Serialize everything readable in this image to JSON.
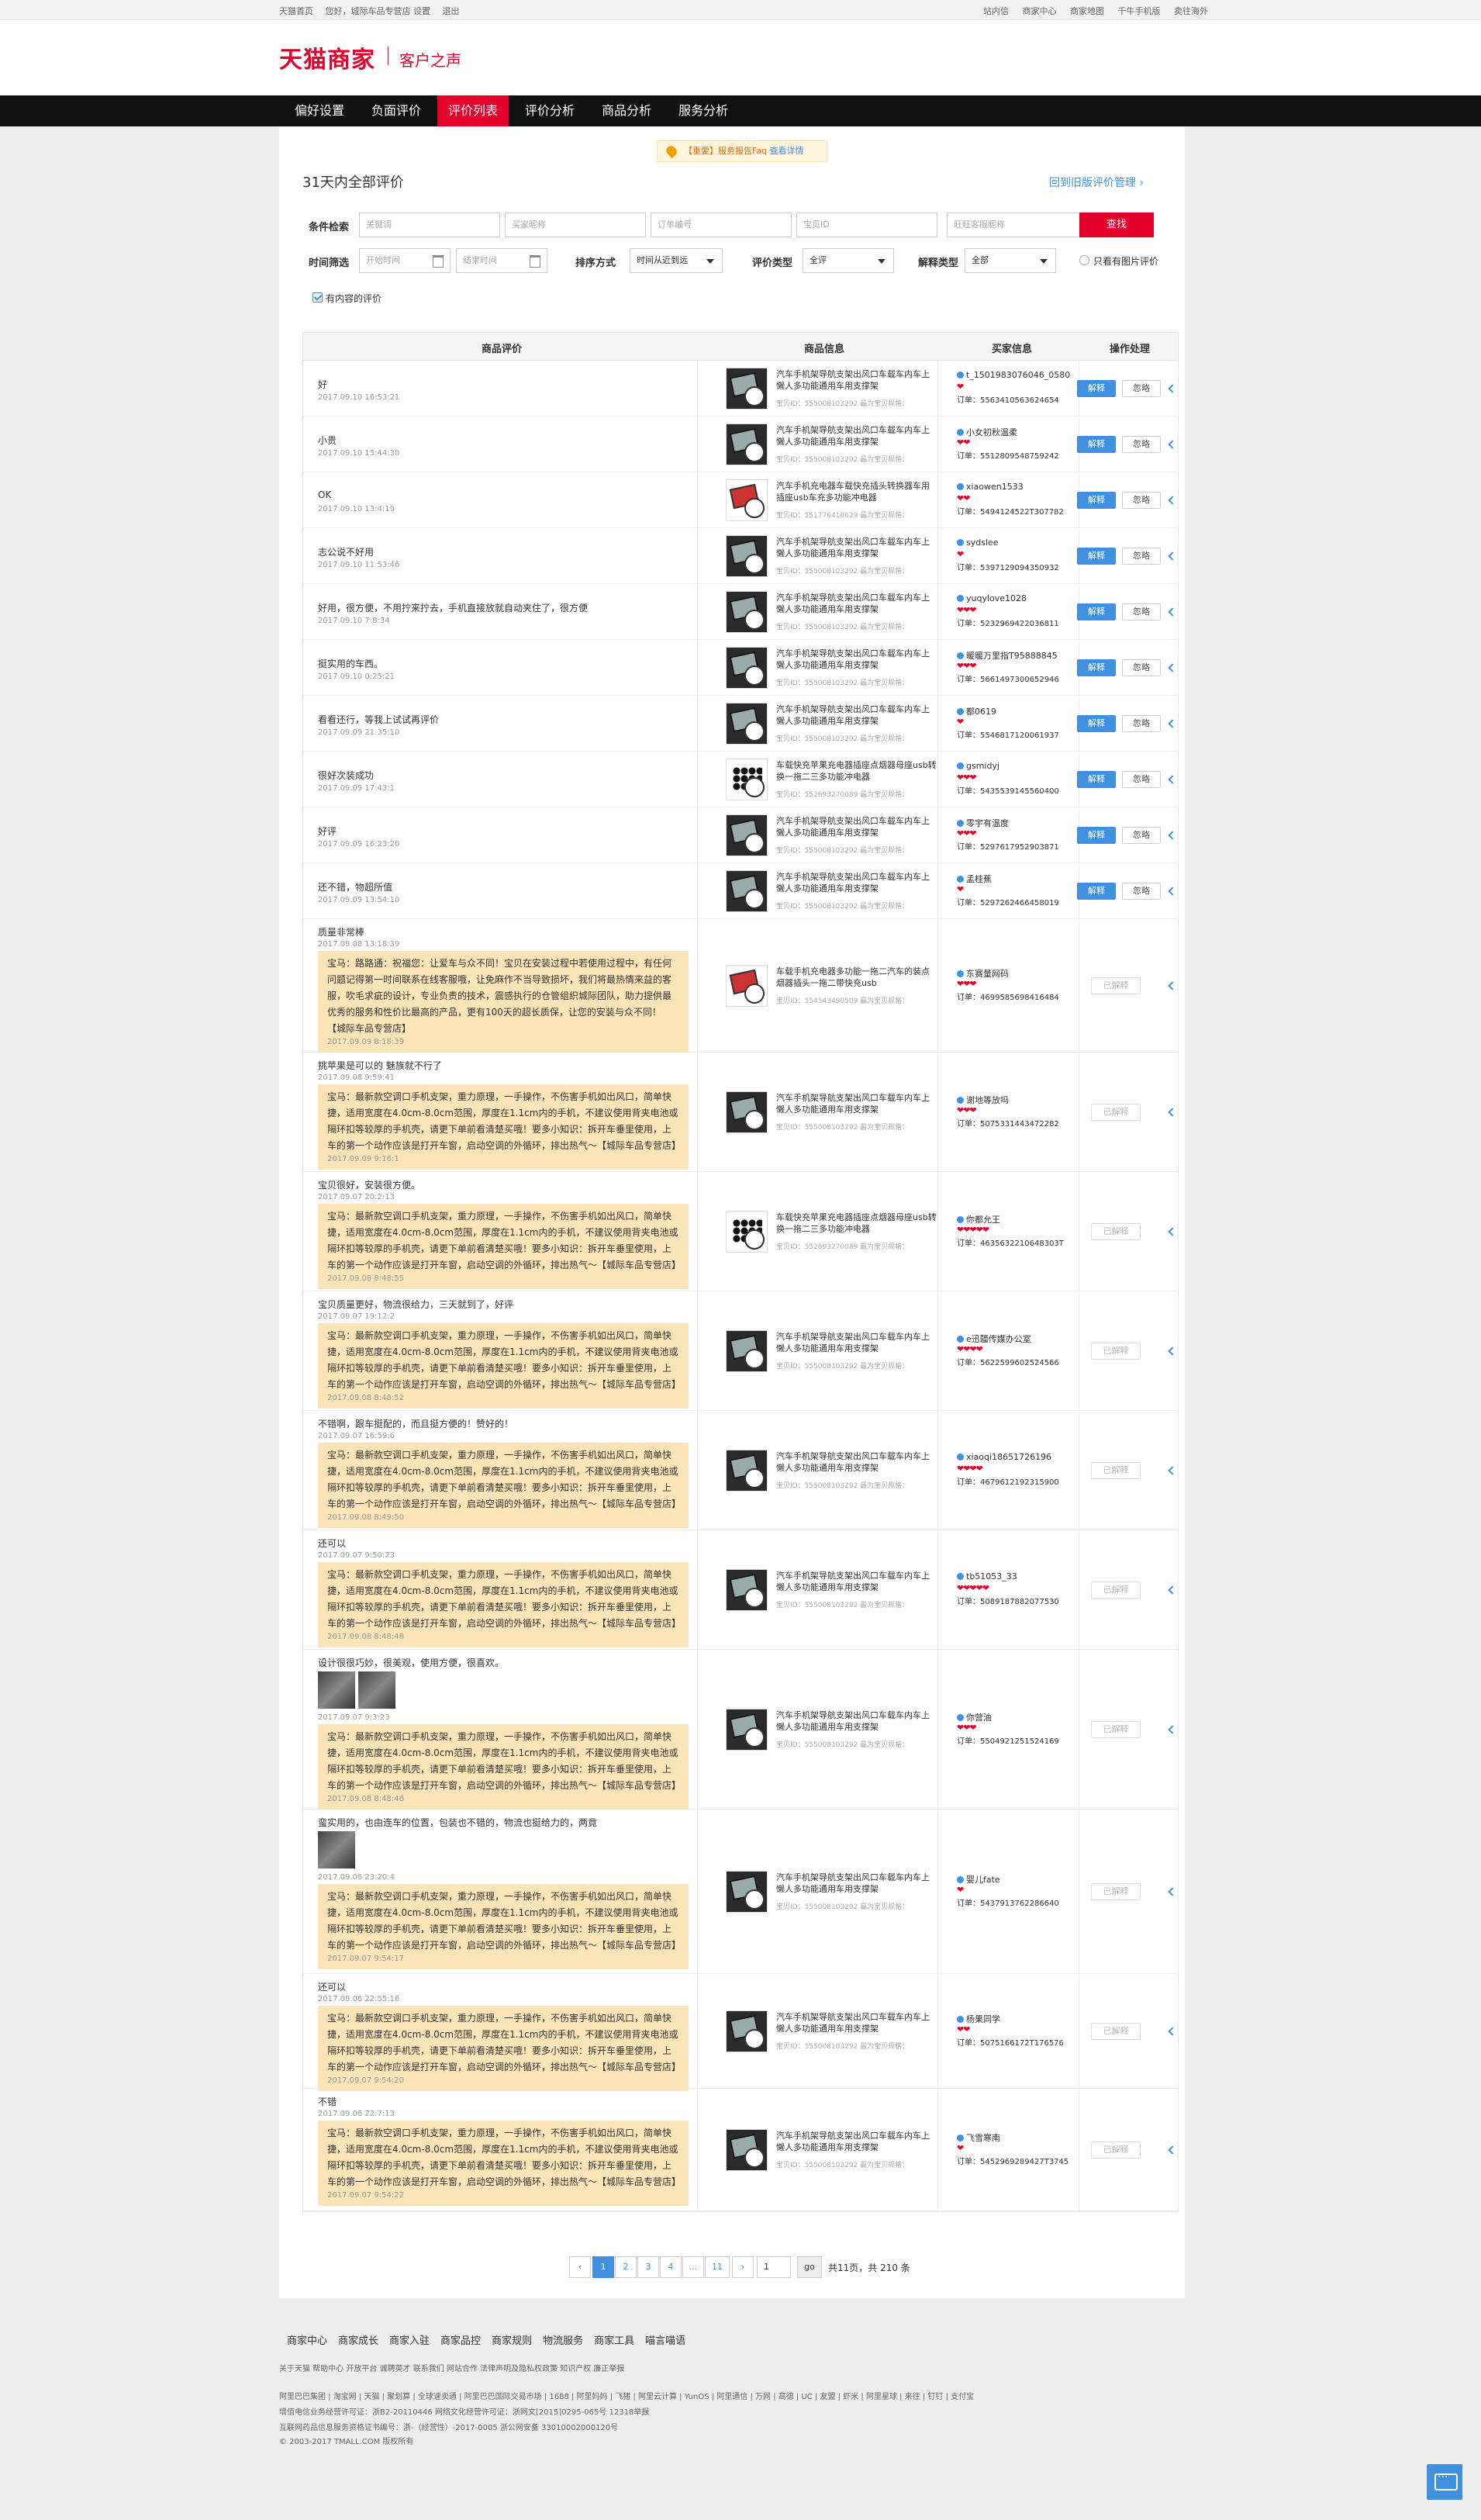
{
  "topbar": {
    "left": [
      "天猫首页",
      "您好，城际车品专营店 设置",
      "退出"
    ],
    "right": [
      "站内信",
      "商家中心",
      "商家地图",
      "千牛手机版",
      "卖往海外"
    ]
  },
  "header": {
    "logo": "天猫商家",
    "subtitle": "客户之声"
  },
  "nav": [
    "偏好设置",
    "负面评价",
    "评价列表",
    "评价分析",
    "商品分析",
    "服务分析"
  ],
  "notice": {
    "tag": "【重要】服务报告Faq",
    "link": "查看详情"
  },
  "page_title": "31天内全部评价",
  "back_link": "回到旧版评价管理 ›",
  "filters": {
    "cond_label": "条件检索",
    "kw": "关键词",
    "buyer": "买家昵称",
    "order": "订单编号",
    "item": "宝贝ID",
    "ww": "旺旺客服昵称",
    "search": "查找",
    "time_label": "时间筛选",
    "start": "开始时间",
    "end": "结束时间",
    "sort_label": "排序方式",
    "sort_val": "时间从近到远",
    "type_label": "评价类型",
    "type_val": "全评",
    "reply_label": "解释类型",
    "reply_val": "全部",
    "img_only": "只看有图片评价",
    "has_content": "有内容的评价"
  },
  "table": {
    "headers": [
      "商品评价",
      "商品信息",
      "买家信息",
      "操作处理"
    ]
  },
  "rows": [
    {
      "text": "好",
      "date": "2017.09.10 16:53:21",
      "pname": "汽车手机架导航支架出风口车载车内车上懒人多功能通用车用支撑架",
      "pid": "宝贝ID：555008103292  最为宝贝规格：",
      "buyer": "t_1501983076046_0580",
      "hearts": "❤",
      "order": "订单：5563410563624654",
      "act": "two"
    },
    {
      "text": "小贵",
      "date": "2017.09.10 15:44:30",
      "pname": "汽车手机架导航支架出风口车载车内车上懒人多功能通用车用支撑架",
      "pid": "宝贝ID：555008103292  最为宝贝规格：",
      "buyer": "小女初秋温柔",
      "hearts": "❤❤",
      "order": "订单：5512809548759242",
      "act": "two"
    },
    {
      "text": "OK",
      "date": "2017.09.10 13:4:19",
      "pname": "汽车手机充电器车载快充插头转换器车用插座usb车充多功能冲电器",
      "pid": "宝贝ID：551776418629  最为宝贝规格：",
      "buyer": "xiaowen1533",
      "hearts": "❤❤",
      "order": "订单：5494124522T307782",
      "act": "two",
      "img": "red"
    },
    {
      "text": "志公说不好用",
      "date": "2017.09.10 11:53:46",
      "pname": "汽车手机架导航支架出风口车载车内车上懒人多功能通用车用支撑架",
      "pid": "宝贝ID：555008103292  最为宝贝规格：",
      "buyer": "sydslee",
      "hearts": "❤",
      "order": "订单：5397129094350932",
      "act": "two"
    },
    {
      "text": "好用，很方便，不用拧来拧去，手机直接放就自动夹住了，很方便",
      "date": "2017.09.10 7:8:34",
      "pname": "汽车手机架导航支架出风口车载车内车上懒人多功能通用车用支撑架",
      "pid": "宝贝ID：555008103292  最为宝贝规格：",
      "buyer": "yuqylove1028",
      "hearts": "❤❤❤",
      "order": "订单：5232969422036811",
      "act": "two"
    },
    {
      "text": "挺实用的车西。",
      "date": "2017.09.10 0:25:21",
      "pname": "汽车手机架导航支架出风口车载车内车上懒人多功能通用车用支撑架",
      "pid": "宝贝ID：555008103292  最为宝贝规格：",
      "buyer": "暖暖万里指T95888845",
      "hearts": "❤❤❤",
      "order": "订单：5661497300652946",
      "act": "two"
    },
    {
      "text": "看看还行，等我上试试再评价",
      "date": "2017.09.09 21:35:10",
      "pname": "汽车手机架导航支架出风口车载车内车上懒人多功能通用车用支撑架",
      "pid": "宝贝ID：555008103292  最为宝贝规格：",
      "buyer": "都0619",
      "hearts": "❤",
      "order": "订单：5546817120061937",
      "act": "two"
    },
    {
      "text": "很好次装成功",
      "date": "2017.09.09 17:43:1",
      "pname": "车载快充苹果充电器插座点烟器母座usb转换一拖二三多功能冲电器",
      "pid": "宝贝ID：552693270089  最为宝贝规格：",
      "buyer": "gsmidyj",
      "hearts": "❤❤❤",
      "order": "订单：5435539145560400",
      "act": "two",
      "img": "dots"
    },
    {
      "text": "好评",
      "date": "2017.09.09 16:23:20",
      "pname": "汽车手机架导航支架出风口车载车内车上懒人多功能通用车用支撑架",
      "pid": "宝贝ID：555008103292  最为宝贝规格：",
      "buyer": "零宇有温度",
      "hearts": "❤❤❤",
      "order": "订单：5297617952903871",
      "act": "two"
    },
    {
      "text": "还不错，物超所值",
      "date": "2017.09.09 13:54:10",
      "pname": "汽车手机架导航支架出风口车载车内车上懒人多功能通用车用支撑架",
      "pid": "宝贝ID：555008103292  最为宝贝规格：",
      "buyer": "孟桂蕉",
      "hearts": "❤",
      "order": "订单：5297262466458019",
      "act": "two"
    },
    {
      "text": "质量非常棒",
      "date": "2017.09.08 13:18:39",
      "reply": "宝马：路路通：祝福您：让爱车与众不同！宝贝在安装过程中若使用过程中，有任何问题记得第一时间联系在线客服哦，让免麻作不当导致损坏，我们将最热情来益的客服，吹毛求疵的设计，专业负责的技术，震感执行的仓管组织城际团队，助力提供最优秀的服务和性价比最高的产品，更有100天的超长质保，让您的安装与众不同！【城际车品专营店】",
      "rdate": "2017.09.09 8:18:39",
      "pname": "车载手机充电器多功能一拖二汽车的装点烟器插头一拖二带快充usb",
      "pid": "宝贝ID：554543490509  最为宝贝规格：",
      "buyer": "东赛量网码",
      "hearts": "❤❤❤",
      "order": "订单：4699585698416484",
      "act": "done",
      "img": "red"
    },
    {
      "text": "挑苹果是可以的 魅族就不行了",
      "date": "2017.09.08 9:59:41",
      "reply": "宝马：最新款空调口手机支架，重力原理，一手操作，不伤害手机如出风口，简单快捷，适用宽度在4.0cm-8.0cm范围，厚度在1.1cm内的手机，不建议使用背夹电池或隔环扣等较厚的手机壳，请更下单前看清楚买哦！要多小知识：拆开车垂里使用，上车的第一个动作应该是打开车窗，启动空调的外循环，排出热气～【城际车品专营店】",
      "rdate": "2017.09.09 9:16:1",
      "pname": "汽车手机架导航支架出风口车载车内车上懒人多功能通用车用支撑架",
      "pid": "宝贝ID：555008103292  最为宝贝规格：",
      "buyer": "谢地等放吗",
      "hearts": "❤❤❤",
      "order": "订单：5075331443472282",
      "act": "done"
    },
    {
      "text": "宝贝很好，安装很方便。",
      "date": "2017.09.07 20:2:13",
      "reply": "宝马：最新款空调口手机支架，重力原理，一手操作，不伤害手机如出风口，简单快捷，适用宽度在4.0cm-8.0cm范围，厚度在1.1cm内的手机，不建议使用背夹电池或隔环扣等较厚的手机壳，请更下单前看清楚买哦！要多小知识：拆开车垂里使用，上车的第一个动作应该是打开车窗，启动空调的外循环，排出热气～【城际车品专营店】",
      "rdate": "2017.09.08 8:48:55",
      "pname": "车载快充苹果充电器插座点烟器母座usb转换一拖二三多功能冲电器",
      "pid": "宝贝ID：552693270089  最为宝贝规格：",
      "buyer": "你都允王",
      "hearts": "❤❤❤❤❤",
      "order": "订单：4635632210648303T",
      "act": "done",
      "img": "dots"
    },
    {
      "text": "宝贝质量更好，物流很给力，三天就到了，好评",
      "date": "2017.09.07 19:12:2",
      "reply": "宝马：最新款空调口手机支架，重力原理，一手操作，不伤害手机如出风口，简单快捷，适用宽度在4.0cm-8.0cm范围，厚度在1.1cm内的手机，不建议使用背夹电池或隔环扣等较厚的手机壳，请更下单前看清楚买哦！要多小知识：拆开车垂里使用，上车的第一个动作应该是打开车窗，启动空调的外循环，排出热气～【城际车品专营店】",
      "rdate": "2017.09.08 8:48:52",
      "pname": "汽车手机架导航支架出风口车载车内车上懒人多功能通用车用支撑架",
      "pid": "宝贝ID：555008103292  最为宝贝规格：",
      "buyer": "e迅疆传媒办公室",
      "hearts": "❤❤❤❤",
      "order": "订单：5622599602524566",
      "act": "done"
    },
    {
      "text": "不错啊，跟车挺配的，而且挺方便的！赞好的！",
      "date": "2017.09.07 16:59:6",
      "reply": "宝马：最新款空调口手机支架，重力原理，一手操作，不伤害手机如出风口，简单快捷，适用宽度在4.0cm-8.0cm范围，厚度在1.1cm内的手机，不建议使用背夹电池或隔环扣等较厚的手机壳，请更下单前看清楚买哦！要多小知识：拆开车垂里使用，上车的第一个动作应该是打开车窗，启动空调的外循环，排出热气～【城际车品专营店】",
      "rdate": "2017.09.08 8:49:50",
      "pname": "汽车手机架导航支架出风口车载车内车上懒人多功能通用车用支撑架",
      "pid": "宝贝ID：555008103292  最为宝贝规格：",
      "buyer": "xiaoqi18651726196",
      "hearts": "❤❤❤❤",
      "order": "订单：4679612192315900",
      "act": "done"
    },
    {
      "text": "还可以",
      "date": "2017.09.07 9:50:23",
      "reply": "宝马：最新款空调口手机支架，重力原理，一手操作，不伤害手机如出风口，简单快捷，适用宽度在4.0cm-8.0cm范围，厚度在1.1cm内的手机，不建议使用背夹电池或隔环扣等较厚的手机壳，请更下单前看清楚买哦！要多小知识：拆开车垂里使用，上车的第一个动作应该是打开车窗，启动空调的外循环，排出热气～【城际车品专营店】",
      "rdate": "2017.09.08 8:48:48",
      "pname": "汽车手机架导航支架出风口车载车内车上懒人多功能通用车用支撑架",
      "pid": "宝贝ID：555008103292  最为宝贝规格：",
      "buyer": "tb51053_33",
      "hearts": "❤❤❤❤❤",
      "order": "订单：5089187882077530",
      "act": "done"
    },
    {
      "text": "设计很很巧妙，很美观，使用方便，很喜欢。",
      "date": "2017.09.07 9:3:23",
      "thumbs": 2,
      "reply": "宝马：最新款空调口手机支架，重力原理，一手操作，不伤害手机如出风口，简单快捷，适用宽度在4.0cm-8.0cm范围，厚度在1.1cm内的手机，不建议使用背夹电池或隔环扣等较厚的手机壳，请更下单前看清楚买哦！要多小知识：拆开车垂里使用，上车的第一个动作应该是打开车窗，启动空调的外循环，排出热气～【城际车品专营店】",
      "rdate": "2017.09.08 8:48:46",
      "pname": "汽车手机架导航支架出风口车载车内车上懒人多功能通用车用支撑架",
      "pid": "宝贝ID：555008103292  最为宝贝规格：",
      "buyer": "你营油",
      "hearts": "❤❤❤",
      "order": "订单：5504921251524169",
      "act": "done"
    },
    {
      "text": "蛮实用的，也由连车的位置，包装也不错的，物流也挺给力的，两竟",
      "date": "2017.09.06 23:20:4",
      "thumbs": 1,
      "reply": "宝马：最新款空调口手机支架，重力原理，一手操作，不伤害手机如出风口，简单快捷，适用宽度在4.0cm-8.0cm范围，厚度在1.1cm内的手机，不建议使用背夹电池或隔环扣等较厚的手机壳，请更下单前看清楚买哦！要多小知识：拆开车垂里使用，上车的第一个动作应该是打开车窗，启动空调的外循环，排出热气～【城际车品专营店】",
      "rdate": "2017.09.07 9:54:17",
      "pname": "汽车手机架导航支架出风口车载车内车上懒人多功能通用车用支撑架",
      "pid": "宝贝ID：555008103292  最为宝贝规格：",
      "buyer": "婴儿fate",
      "hearts": "❤",
      "order": "订单：5437913762286640",
      "act": "done"
    },
    {
      "text": "还可以",
      "date": "2017.09.06 22:55:16",
      "reply": "宝马：最新款空调口手机支架，重力原理，一手操作，不伤害手机如出风口，简单快捷，适用宽度在4.0cm-8.0cm范围，厚度在1.1cm内的手机，不建议使用背夹电池或隔环扣等较厚的手机壳，请更下单前看清楚买哦！要多小知识：拆开车垂里使用，上车的第一个动作应该是打开车窗，启动空调的外循环，排出热气～【城际车品专营店】",
      "rdate": "2017.09.07 9:54:20",
      "pname": "汽车手机架导航支架出风口车载车内车上懒人多功能通用车用支撑架",
      "pid": "宝贝ID：555008103292  最为宝贝规格：",
      "buyer": "杨果同学",
      "hearts": "❤❤",
      "order": "订单：5075166172T176576",
      "act": "done"
    },
    {
      "text": "不错",
      "date": "2017.09.06 22:7:13",
      "reply": "宝马：最新款空调口手机支架，重力原理，一手操作，不伤害手机如出风口，简单快捷，适用宽度在4.0cm-8.0cm范围，厚度在1.1cm内的手机，不建议使用背夹电池或隔环扣等较厚的手机壳，请更下单前看清楚买哦！要多小知识：拆开车垂里使用，上车的第一个动作应该是打开车窗，启动空调的外循环，排出热气～【城际车品专营店】",
      "rdate": "2017.09.07 9:54:22",
      "pname": "汽车手机架导航支架出风口车载车内车上懒人多功能通用车用支撑架",
      "pid": "宝贝ID：555008103292  最为宝贝规格：",
      "buyer": "飞雪寒南",
      "hearts": "❤",
      "order": "订单：5452969289427T3745",
      "act": "done"
    }
  ],
  "actions": {
    "reply": "解释",
    "ignore": "忽略",
    "done": "已解释"
  },
  "pager": {
    "pages": [
      "1",
      "2",
      "3",
      "4",
      "...",
      "11"
    ],
    "input": "1",
    "go": "go",
    "summary": "共11页，共 210 条"
  },
  "footer": {
    "main": [
      "商家中心",
      "商家成长",
      "商家入驻",
      "商家品控",
      "商家规则",
      "物流服务",
      "商家工具",
      "喵言喵语"
    ],
    "line1": "关于天猫  帮助中心  开放平台  诚聘英才  联系我们  网站合作  法律声明及隐私权政策  知识产权  廉正举报",
    "line2": "阿里巴巴集团 | 淘宝网 | 天猫 | 聚划算 | 全球速卖通 | 阿里巴巴国际交易市场 | 1688 | 阿里妈妈 | 飞猪 | 阿里云计算 | YunOS | 阿里通信 | 万网 | 高德 | UC | 友盟 | 虾米 | 阿里星球 | 来往 | 钉钉 | 支付宝",
    "line3": "增值电信业务经营许可证：浙B2-20110446       网络文化经营许可证：浙网文[2015]0295-065号       12318举报",
    "line4": "互联网药品信息服务资格证书编号：浙-（经营性）-2017-0005       浙公网安备 33010002000120号",
    "line5": "© 2003-2017 TMALL.COM 版权所有"
  }
}
